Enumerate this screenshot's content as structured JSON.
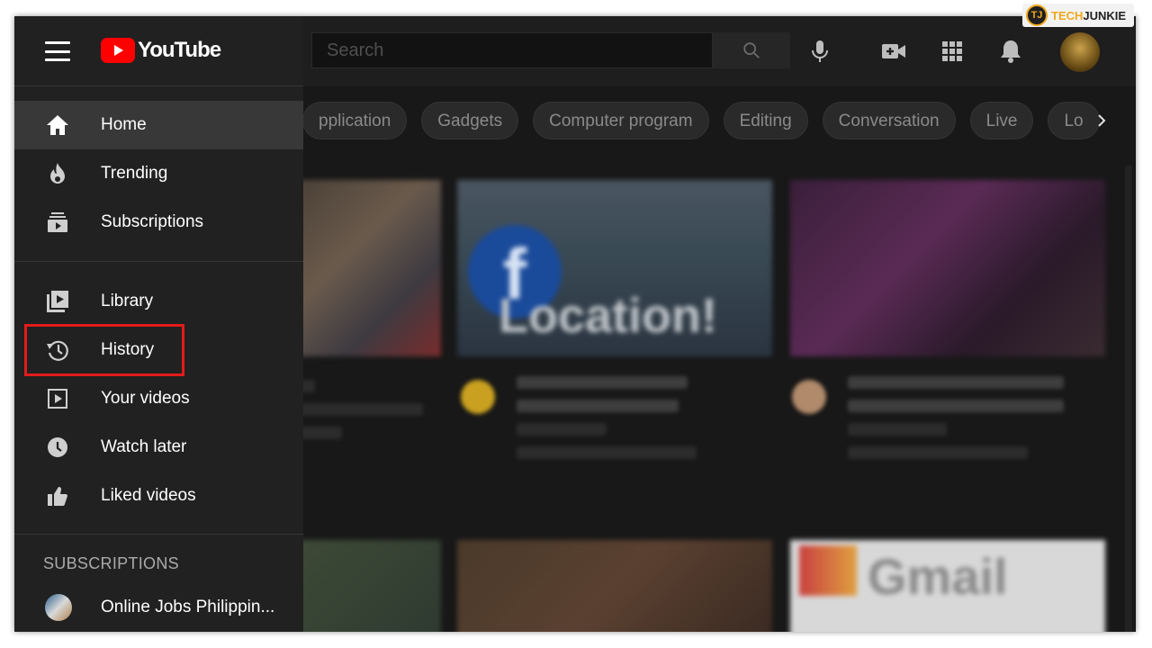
{
  "watermark": {
    "prefix": "TECH",
    "suffix": "JUNKIE",
    "badge": "TJ"
  },
  "app": {
    "logo_text": "YouTube",
    "accent": "#ff0000"
  },
  "header": {
    "search_placeholder": "Search",
    "icons": [
      "search-icon",
      "microphone-icon",
      "create-video-icon",
      "apps-grid-icon",
      "notifications-bell-icon",
      "account-avatar"
    ]
  },
  "chips": [
    "pplication",
    "Gadgets",
    "Computer program",
    "Editing",
    "Conversation",
    "Live",
    "Lo"
  ],
  "sidebar": {
    "primary": [
      {
        "label": "Home",
        "icon": "home-icon",
        "active": true
      },
      {
        "label": "Trending",
        "icon": "trending-flame-icon"
      },
      {
        "label": "Subscriptions",
        "icon": "subscriptions-icon"
      }
    ],
    "library": [
      {
        "label": "Library",
        "icon": "library-icon"
      },
      {
        "label": "History",
        "icon": "history-icon",
        "highlighted": true
      },
      {
        "label": "Your videos",
        "icon": "your-videos-icon"
      },
      {
        "label": "Watch later",
        "icon": "watch-later-clock-icon"
      },
      {
        "label": "Liked videos",
        "icon": "thumbs-up-icon"
      }
    ],
    "subscriptions_title": "SUBSCRIPTIONS",
    "subscriptions": [
      {
        "label": "Online Jobs Philippin..."
      }
    ]
  },
  "videos": {
    "thumb2_text": "Location!",
    "thumb6_text": "Gmail"
  },
  "colors": {
    "highlight": "#e31b1b",
    "background": "#181818",
    "sidebar": "#212121"
  }
}
